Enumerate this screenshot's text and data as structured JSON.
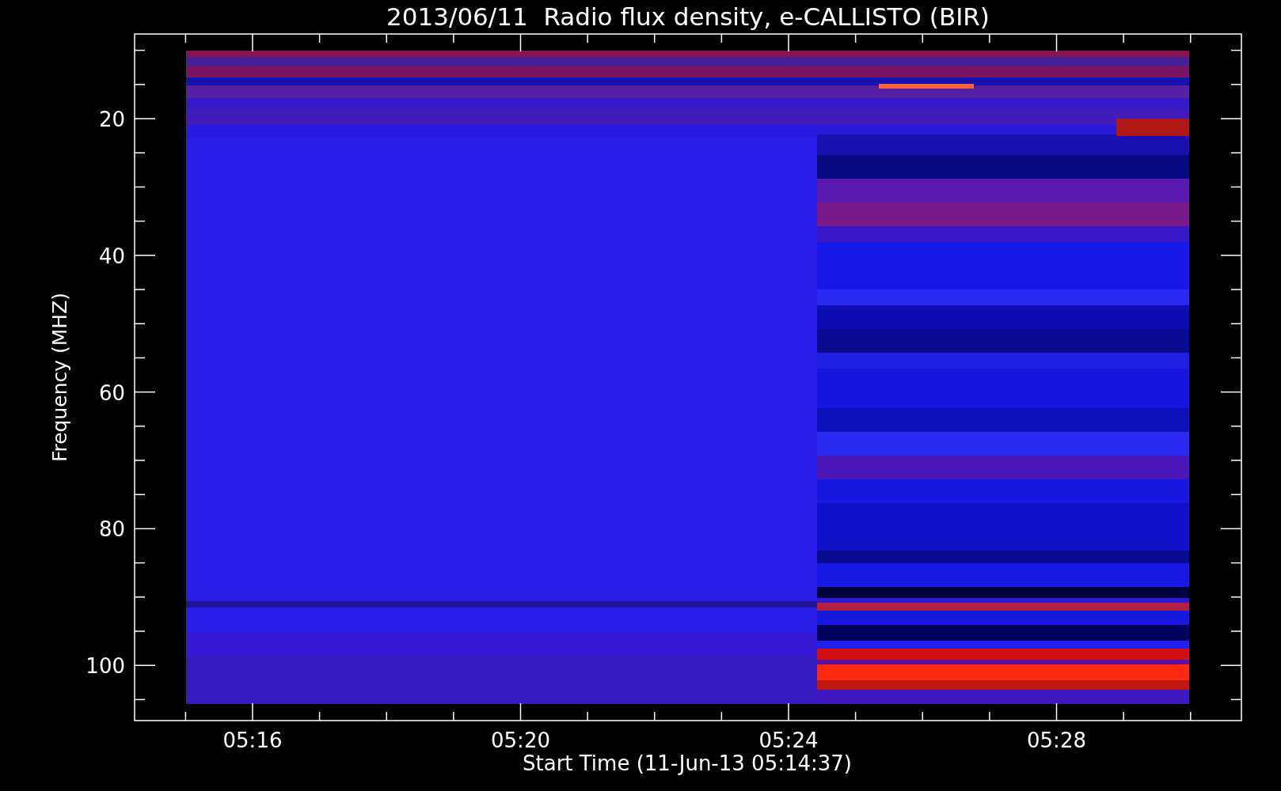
{
  "plot": {
    "title": "2013/06/11  Radio flux density, e-CALLISTO (BIR)",
    "y_axis": {
      "label": "Frequency (MHZ)",
      "ticks": [
        "20",
        "40",
        "60",
        "80",
        "100"
      ]
    },
    "x_axis": {
      "label": "Start Time (11-Jun-13 05:14:37)",
      "ticks": [
        "05:16",
        "05:20",
        "05:24",
        "05:28"
      ]
    }
  }
}
